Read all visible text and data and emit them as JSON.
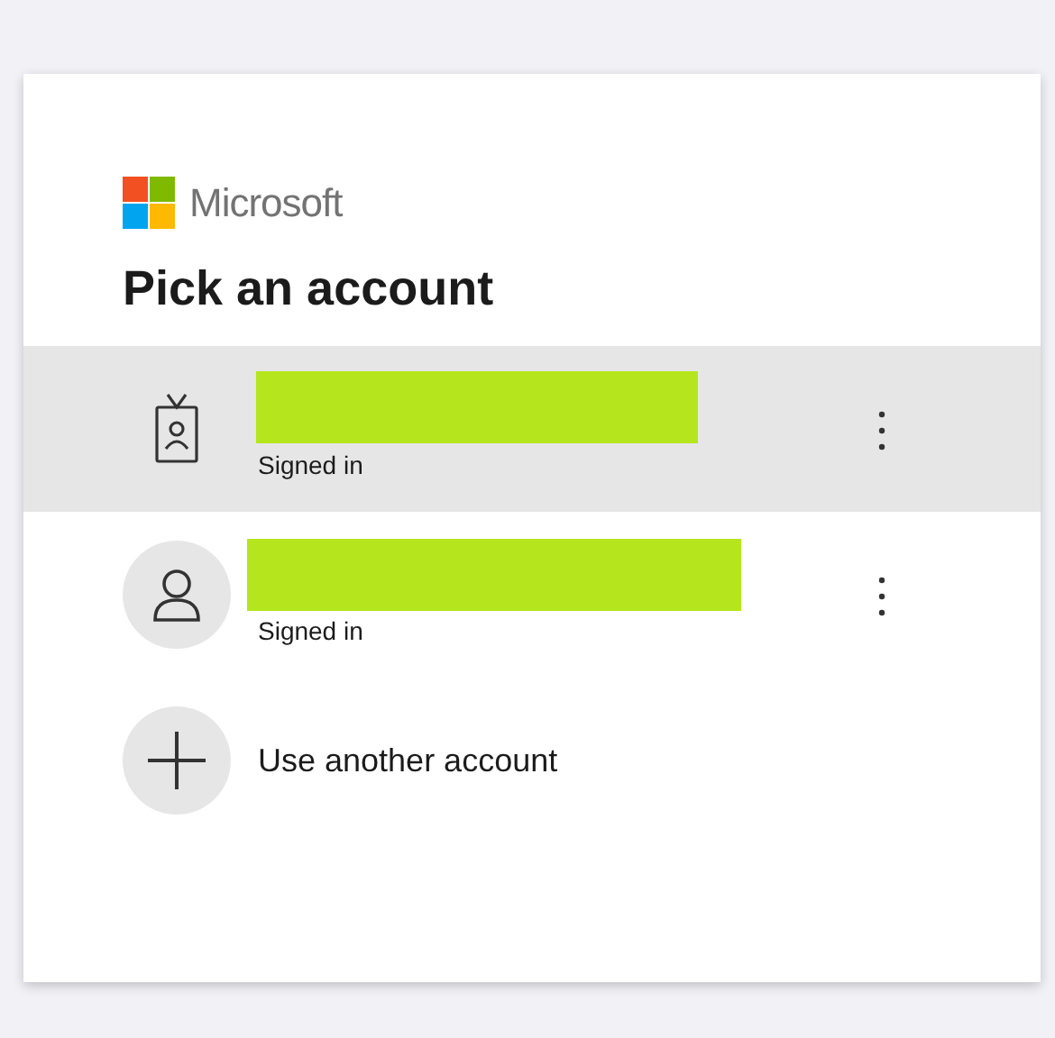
{
  "brand": "Microsoft",
  "heading": "Pick an account",
  "accounts": [
    {
      "kind": "work",
      "status": "Signed in",
      "selected": true
    },
    {
      "kind": "personal",
      "status": "Signed in",
      "selected": false
    }
  ],
  "add_account": {
    "label": "Use another account"
  }
}
